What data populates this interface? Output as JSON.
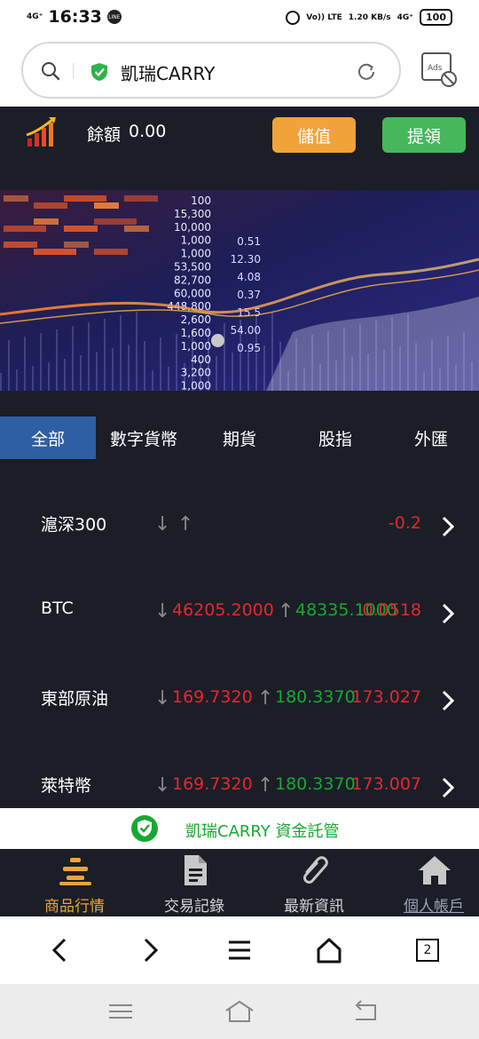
{
  "status_bar": {
    "network_top": "4G⁺",
    "time": "16:33",
    "line_badge": "LINE",
    "volte": "Vo)) LTE",
    "speed": "1.20 KB/s",
    "network_right": "4G⁺",
    "battery": "100"
  },
  "browser": {
    "site_title": "凱瑞CARRY",
    "ads_label": "Ads"
  },
  "header": {
    "balance_label": "餘額",
    "balance_value": "0.00",
    "deposit_label": "儲值",
    "withdraw_label": "提領",
    "deposit_color": "#f1a33a",
    "withdraw_color": "#45b85a"
  },
  "banner": {
    "ticker_numbers": [
      "100",
      "15,300",
      "10,000",
      "1,000",
      "1,000",
      "53,500",
      "82,700",
      "60,000",
      "448,800",
      "2,600",
      "1,600",
      "1,000",
      "400",
      "3,200",
      "1,000"
    ],
    "right_numbers": [
      "0.51",
      "12.30",
      "4.08",
      "0.37",
      "15.5",
      "54.00",
      "0.95"
    ]
  },
  "tabs": [
    {
      "label": "全部",
      "active": true
    },
    {
      "label": "數字貨幣",
      "active": false
    },
    {
      "label": "期貨",
      "active": false
    },
    {
      "label": "股指",
      "active": false
    },
    {
      "label": "外匯",
      "active": false
    }
  ],
  "markets": [
    {
      "name": "滬深300",
      "low_arrow": "↓",
      "low": "",
      "high_arrow": "↑",
      "high": "",
      "change": "-0.2"
    },
    {
      "name": "BTC",
      "low_arrow": "↓",
      "low": "46205.2000",
      "high_arrow": "↑",
      "high": "48335.1000",
      "change": "0.0518"
    },
    {
      "name": "東部原油",
      "low_arrow": "↓",
      "low": "169.7320",
      "high_arrow": "↑",
      "high": "180.3370",
      "change": "173.027"
    },
    {
      "name": "萊特幣",
      "low_arrow": "↓",
      "low": "169.7320",
      "high_arrow": "↑",
      "high": "180.3370",
      "change": "173.007"
    }
  ],
  "trust": {
    "text": "凱瑞CARRY 資金託管"
  },
  "app_nav": [
    {
      "label": "商品行情",
      "icon": "market-stack-icon",
      "active": true
    },
    {
      "label": "交易記錄",
      "icon": "document-icon",
      "active": false
    },
    {
      "label": "最新資訊",
      "icon": "paperclip-icon",
      "active": false
    },
    {
      "label": "個人帳戶",
      "icon": "home-icon",
      "active": false
    }
  ],
  "browser_nav": {
    "tab_count": "2"
  },
  "colors": {
    "background": "#1b1e27",
    "active_tab": "#2e5fa5",
    "down": "#e5282e",
    "up": "#18a832",
    "accent": "#f1a33a"
  }
}
